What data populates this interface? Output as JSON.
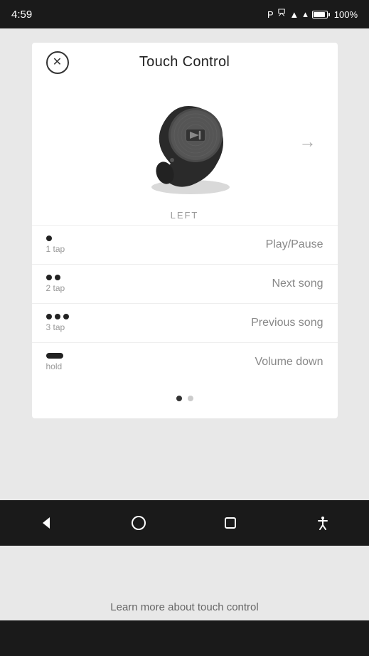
{
  "statusBar": {
    "time": "4:59",
    "battery": "100%",
    "icons": [
      "bluetooth",
      "sim",
      "wifi",
      "battery"
    ]
  },
  "card": {
    "title": "Touch Control",
    "closeButton": "×",
    "sideLabel": "LEFT",
    "arrowLabel": "→",
    "controls": [
      {
        "dots": 1,
        "tapLabel": "1 tap",
        "action": "Play/Pause",
        "type": "dot"
      },
      {
        "dots": 2,
        "tapLabel": "2 tap",
        "action": "Next song",
        "type": "dot"
      },
      {
        "dots": 3,
        "tapLabel": "3 tap",
        "action": "Previous song",
        "type": "dot"
      },
      {
        "dots": 0,
        "tapLabel": "hold",
        "action": "Volume down",
        "type": "hold"
      }
    ],
    "pagination": {
      "current": 0,
      "total": 2
    }
  },
  "bottomText": "Learn more about touch control",
  "navBar": {
    "items": [
      "back",
      "home",
      "square",
      "accessibility"
    ]
  }
}
